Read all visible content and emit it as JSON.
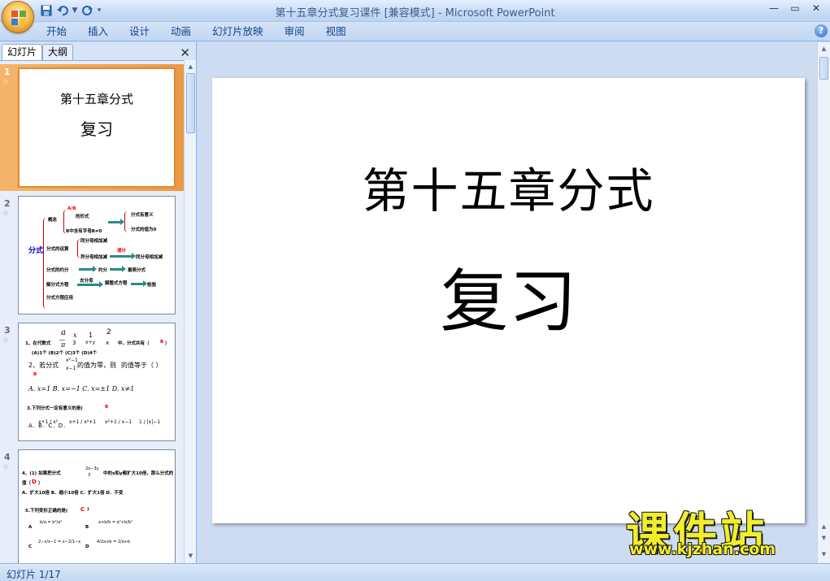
{
  "window": {
    "title": "第十五章分式复习课件 [兼容模式] - Microsoft PowerPoint"
  },
  "qat": {
    "save_icon": "save-icon",
    "undo_icon": "undo-icon",
    "redo_icon": "redo-icon"
  },
  "ribbon": {
    "tabs": [
      "开始",
      "插入",
      "设计",
      "动画",
      "幻灯片放映",
      "审阅",
      "视图"
    ]
  },
  "left_pane": {
    "tabs": [
      "幻灯片",
      "大纲"
    ],
    "slides": [
      {
        "number": "1",
        "selected": true,
        "title": "第十五章分式",
        "subtitle": "复习"
      },
      {
        "number": "2",
        "selected": false
      },
      {
        "number": "3",
        "selected": false
      },
      {
        "number": "4",
        "selected": false
      }
    ],
    "slide2": {
      "concept": "概念",
      "form_text": "的形式",
      "b_condition": "B中含有字母B≠0",
      "meaningful": "分式有意义",
      "zero_value": "分式的值为0",
      "operations": "分式的运算",
      "same_denominator": "同分母相加减",
      "different_denominator": "异分母相加减",
      "common_denominator": "通分",
      "same_denominator_2": "同分母相加减",
      "reduction": "分式的约分",
      "reduce": "约分",
      "simplest": "最简分式",
      "fraction_label": "分式",
      "equations": "解分式方程",
      "remove_denominator": "去分母",
      "integral_equation": "解整式方程",
      "check": "检验",
      "application": "分式方程应用"
    },
    "slide3": {
      "q1": "1、在代数式",
      "q1_tail": "中，分式共有（",
      "q1_ans": "B",
      "q1_close": "）",
      "q1_options": "(A)1个  (B)2个  (C)3个  (D)4个",
      "q2": "2、若分式",
      "q2_tail": "的值为零，则",
      "q2_tail2": "的值等于（  ）",
      "q2_ans": "B",
      "q2_opts": "A. x=1   B. x=−1   C. x=±1   D. x≠1",
      "q3": "3.下列分式一定有意义的是(",
      "q3_ans": "B",
      "q3_opts": "A.      B.      C.      D."
    },
    "slide4": {
      "q4": "4、(1) 如果把分式",
      "q4_tail": "中的x和y都扩大10倍，那么分式的",
      "q4_line2": "值（",
      "q4_ans": "D",
      "q4_close": "）",
      "q4_opts": "A．扩大10倍    B．缩小10倍    C．扩大1倍    D．不变",
      "q5": "5.下列变形正确的是(",
      "q5_ans": "C",
      "q5_close": ")",
      "q5_a": "A",
      "q5_b": "B",
      "q5_c": "C",
      "q5_d": "D"
    }
  },
  "slide": {
    "title": "第十五章分式",
    "subtitle": "复习"
  },
  "watermark": {
    "text": "课件站",
    "url": "www.kjzhan.com"
  },
  "statusbar": {
    "slide_indicator": "幻灯片 1/17"
  }
}
